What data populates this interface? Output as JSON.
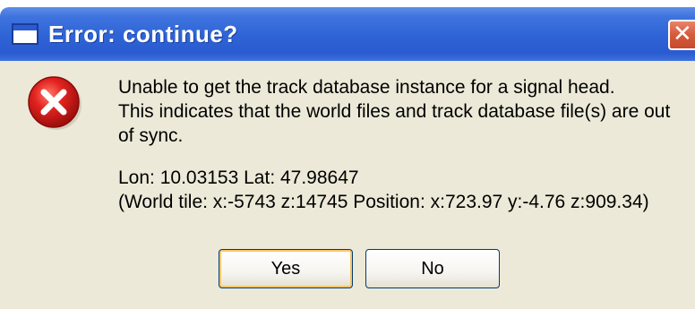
{
  "window": {
    "title": "Error: continue?",
    "close_glyph": "✕"
  },
  "icon": {
    "name": "error-icon"
  },
  "message": {
    "line1": "Unable to get the track database instance for a signal head.",
    "line2": "This indicates that the world files and track database file(s) are out",
    "line3": "of sync.",
    "coords": "Lon: 10.03153 Lat: 47.98647",
    "tile": "(World tile: x:-5743 z:14745  Position: x:723.97 y:-4.76 z:909.34)"
  },
  "buttons": {
    "yes_label": "Yes",
    "no_label": "No"
  },
  "colors": {
    "titlebar": "#2a5bd0",
    "dialog_bg": "#ece9d8",
    "error_red": "#d81e1e"
  }
}
